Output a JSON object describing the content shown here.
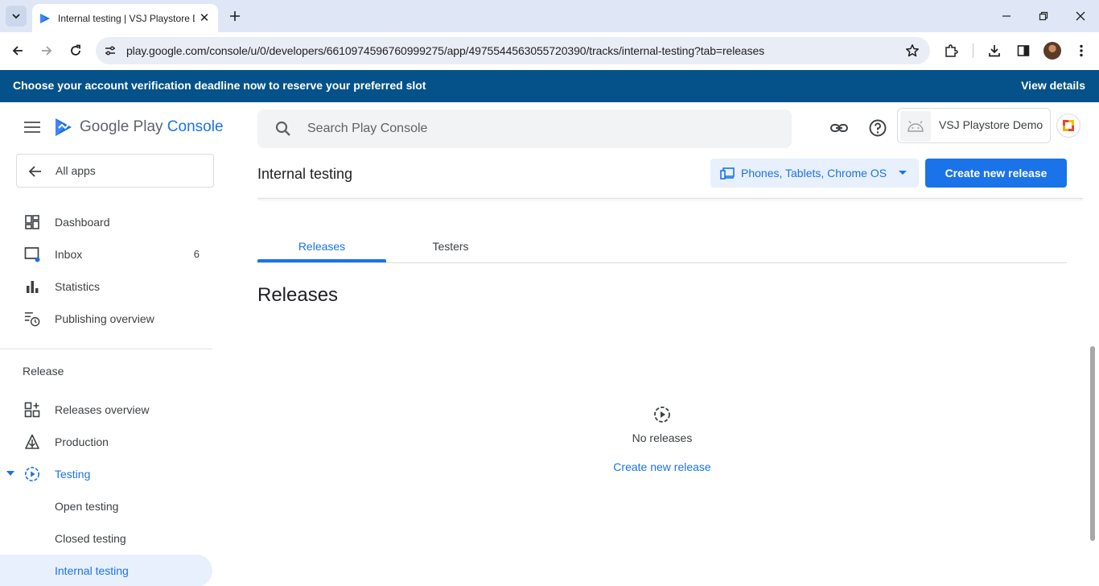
{
  "browser": {
    "tab_title": "Internal testing | VSJ Playstore D",
    "url": "play.google.com/console/u/0/developers/6610974596760999275/app/4975544563055720390/tracks/internal-testing?tab=releases"
  },
  "banner": {
    "text": "Choose your account verification deadline now to reserve your preferred slot",
    "link": "View details"
  },
  "sidebar": {
    "logo": {
      "main": "Google Play ",
      "accent": "Console"
    },
    "all_apps": "All apps",
    "items": [
      {
        "label": "Dashboard",
        "icon": "dashboard-icon"
      },
      {
        "label": "Inbox",
        "icon": "inbox-icon",
        "count": "6"
      },
      {
        "label": "Statistics",
        "icon": "bar-chart-icon"
      },
      {
        "label": "Publishing overview",
        "icon": "publishing-icon"
      }
    ],
    "section": "Release",
    "release_items": [
      {
        "label": "Releases overview",
        "icon": "grid-plus-icon"
      },
      {
        "label": "Production",
        "icon": "production-icon"
      },
      {
        "label": "Testing",
        "icon": "testing-icon"
      },
      {
        "label": "Open testing"
      },
      {
        "label": "Closed testing"
      },
      {
        "label": "Internal testing"
      }
    ]
  },
  "header": {
    "search_placeholder": "Search Play Console",
    "app_name": "VSJ Playstore Demo"
  },
  "page": {
    "title": "Internal testing",
    "device_filter": "Phones, Tablets, Chrome OS",
    "primary_button": "Create new release",
    "tabs": [
      "Releases",
      "Testers"
    ],
    "section_heading": "Releases",
    "empty_state": {
      "text": "No releases",
      "link": "Create new release"
    }
  },
  "colors": {
    "accent": "#1a73e8",
    "banner": "#05528a",
    "selected_bg": "#e8f0fe"
  }
}
